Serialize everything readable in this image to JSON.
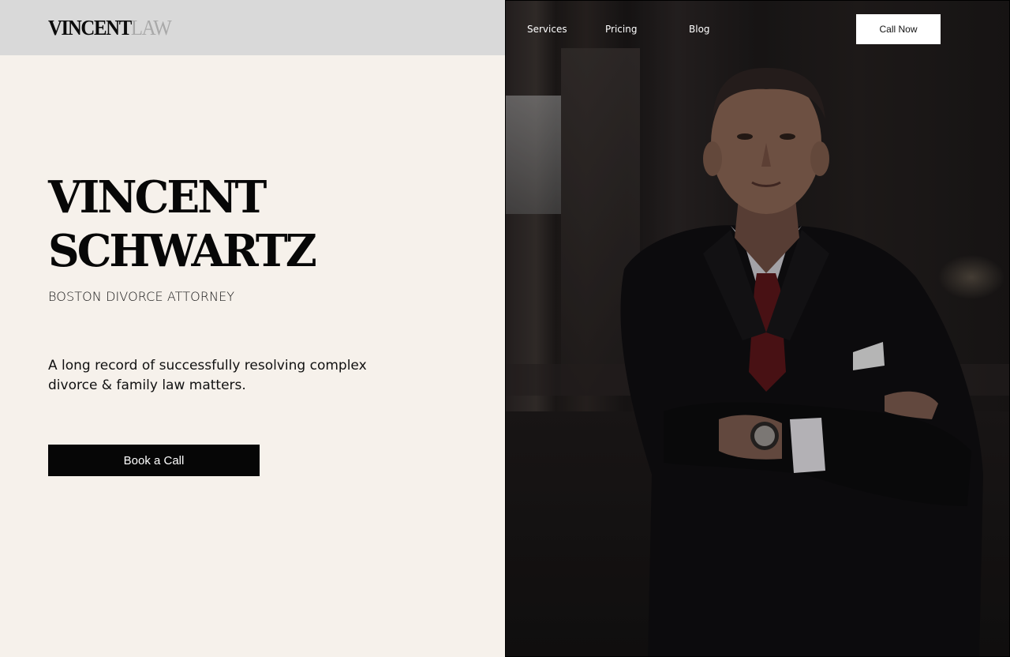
{
  "header": {
    "logo_bold": "VINCENT",
    "logo_light": "LAW",
    "nav": [
      "Services",
      "Pricing",
      "Blog"
    ],
    "call_button": "Call Now"
  },
  "hero": {
    "name_line1": "VINCENT",
    "name_line2": "SCHWARTZ",
    "subtitle": "BOSTON DIVORCE ATTORNEY",
    "description": "A long record of successfully resolving complex divorce & family law matters.",
    "cta": "Book a Call"
  },
  "colors": {
    "background": "#f6f1eb",
    "header_bar": "#d9d9d9",
    "primary": "#060606",
    "logo_light": "#a9a9a9"
  }
}
